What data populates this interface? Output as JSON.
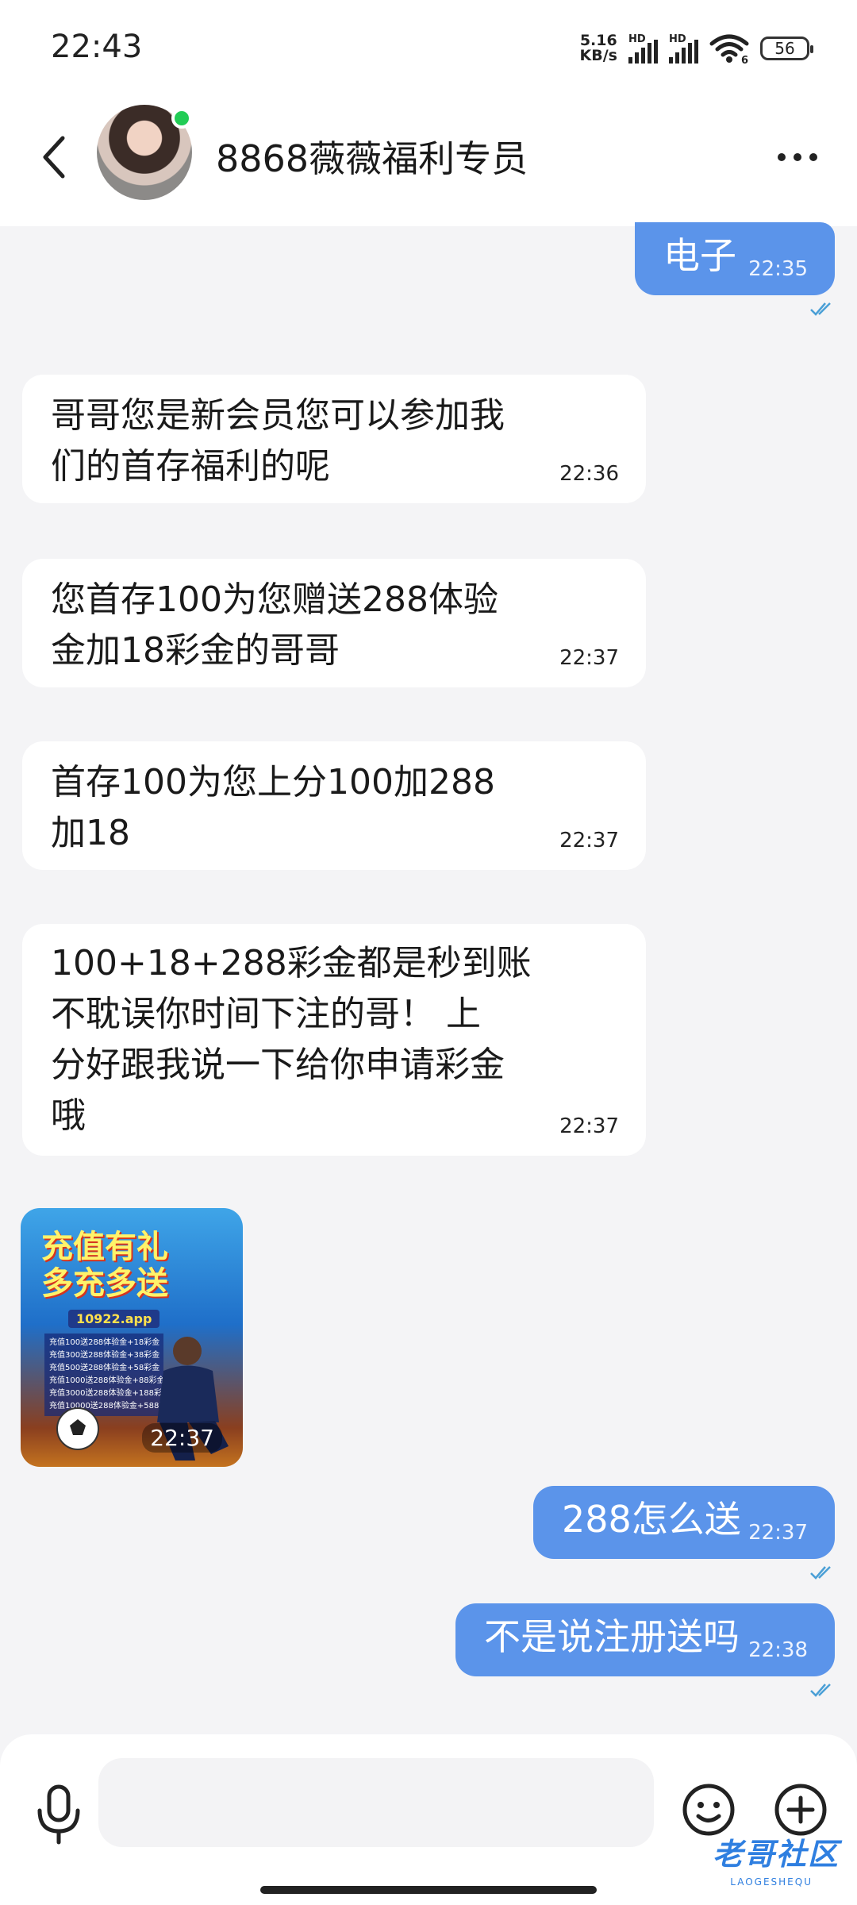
{
  "status_bar": {
    "time": "22:43",
    "net_speed_value": "5.16",
    "net_speed_unit": "KB/s",
    "hd_label": "HD",
    "wifi_badge": "6",
    "battery": "56"
  },
  "header": {
    "contact_name": "8868薇薇福利专员",
    "online": true
  },
  "messages": [
    {
      "direction": "out",
      "text": "电子",
      "time": "22:35",
      "read": true
    },
    {
      "direction": "in",
      "lines": [
        "哥哥您是新会员您可以参加我",
        "们的首存福利的呢"
      ],
      "time": "22:36"
    },
    {
      "direction": "in",
      "lines": [
        "您首存100为您赠送288体验",
        "金加18彩金的哥哥"
      ],
      "time": "22:37"
    },
    {
      "direction": "in",
      "lines": [
        "首存100为您上分100加288",
        "加18"
      ],
      "time": "22:37"
    },
    {
      "direction": "in",
      "lines": [
        "100+18+288彩金都是秒到账",
        "不耽误你时间下注的哥！ 上",
        "分好跟我说一下给你申请彩金",
        "哦"
      ],
      "time": "22:37"
    },
    {
      "direction": "in",
      "type": "image",
      "time": "22:37",
      "image": {
        "title_lines": [
          "充值有礼",
          "多充多送"
        ],
        "domain": "10922.app",
        "offer_lines": [
          "充值100送288体验金+18彩金",
          "充值300送288体验金+38彩金",
          "充值500送288体验金+58彩金",
          "充值1000送288体验金+88彩金",
          "充值3000送288体验金+188彩金",
          "充值10000送288体验金+588彩金"
        ]
      }
    },
    {
      "direction": "out",
      "text": "288怎么送",
      "time": "22:37",
      "read": true
    },
    {
      "direction": "out",
      "text": "不是说注册送吗",
      "time": "22:38",
      "read": true
    }
  ],
  "input": {
    "value": ""
  },
  "watermark": {
    "text": "老哥社区",
    "sub": "LAOGESHEQU"
  },
  "colors": {
    "outgoing_bubble": "#5b94ea",
    "incoming_bubble": "#ffffff",
    "background": "#f4f4f6",
    "online": "#22cc55",
    "read_ticks": "#4a9fd6"
  }
}
